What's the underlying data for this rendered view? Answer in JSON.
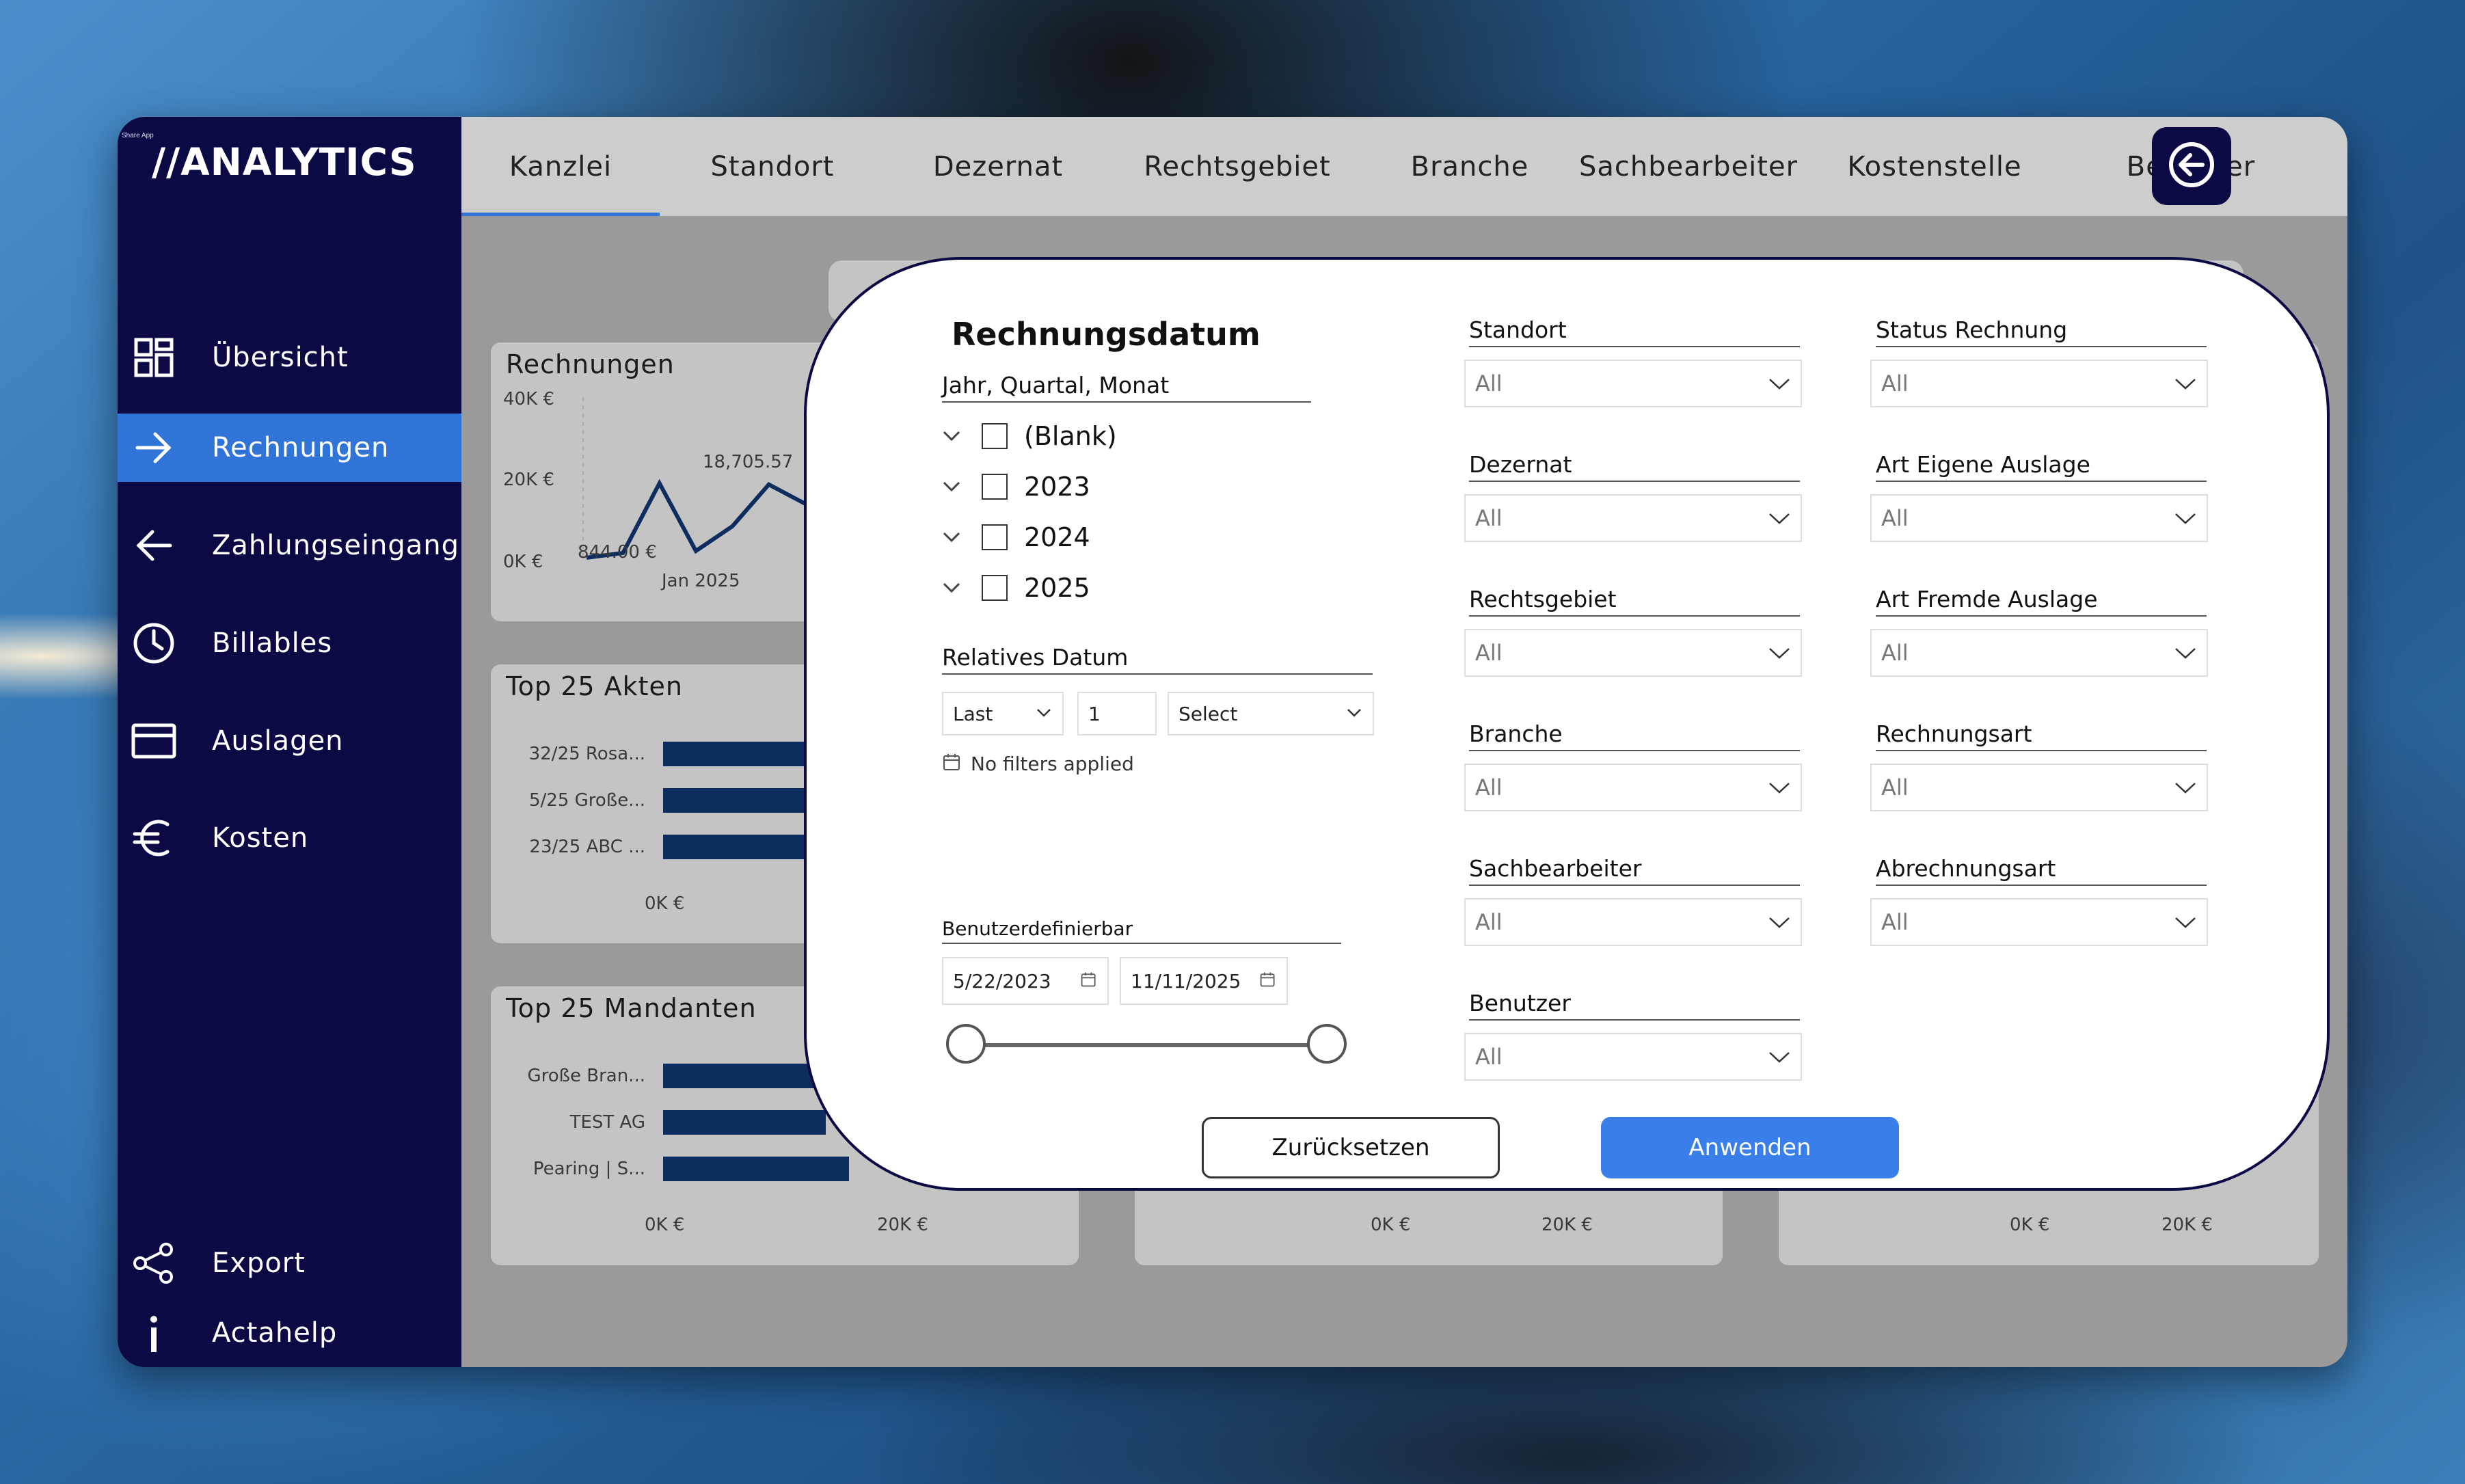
{
  "app": {
    "share_label": "Share App",
    "logo": "//ANALYTICS"
  },
  "sidebar": {
    "items": [
      {
        "label": "Übersicht",
        "icon": "dashboard-icon"
      },
      {
        "label": "Rechnungen",
        "icon": "arrow-right-icon",
        "active": true
      },
      {
        "label": "Zahlungseingang",
        "icon": "arrow-left-icon"
      },
      {
        "label": "Billables",
        "icon": "clock-icon"
      },
      {
        "label": "Auslagen",
        "icon": "card-icon"
      },
      {
        "label": "Kosten",
        "icon": "euro-icon"
      }
    ],
    "bottom": [
      {
        "label": "Export",
        "icon": "share-icon"
      },
      {
        "label": "Actahelp",
        "icon": "info-icon"
      }
    ]
  },
  "tabs": [
    "Kanzlei",
    "Standort",
    "Dezernat",
    "Rechtsgebiet",
    "Branche",
    "Sachbearbeiter",
    "Kostenstelle",
    "Benutzer"
  ],
  "active_tab": "Kanzlei",
  "cards": {
    "rechnungen": {
      "title": "Rechnungen",
      "y_ticks": [
        "40K €",
        "20K €",
        "0K €"
      ],
      "data_labels": [
        "18,705.57",
        "844.00 €"
      ],
      "x_label": "Jan 2025"
    },
    "top_akten": {
      "title": "Top 25 Akten",
      "rows": [
        "32/25 Rosa...",
        "5/25 Große...",
        "23/25 ABC ..."
      ],
      "x_ticks": [
        "0K €"
      ]
    },
    "top_mandanten": {
      "title": "Top 25 Mandanten",
      "rows": [
        "Große Bran...",
        "TEST AG",
        "Pearing | S..."
      ],
      "x_ticks": [
        "0K €",
        "20K €"
      ]
    },
    "mid_card": {
      "x_ticks": [
        "0K €",
        "20K €"
      ]
    },
    "right_card": {
      "x_ticks": [
        "0K €",
        "20K €"
      ]
    }
  },
  "chart_data": [
    {
      "type": "line",
      "title": "Rechnungen",
      "ylim": [
        0,
        40000
      ],
      "y_ticks": [
        "40K €",
        "20K €",
        "0K €"
      ],
      "x_label": "Jan 2025",
      "values": [
        844,
        2000,
        19000,
        2500,
        8500,
        18705.57,
        14000
      ],
      "annotations": [
        "18,705.57",
        "844.00 €"
      ]
    },
    {
      "type": "bar",
      "title": "Top 25 Akten",
      "categories": [
        "32/25 Rosa...",
        "5/25 Große...",
        "23/25 ABC ..."
      ]
    },
    {
      "type": "bar",
      "title": "Top 25 Mandanten",
      "categories": [
        "Große Bran...",
        "TEST AG",
        "Pearing | S..."
      ],
      "values": [
        17500,
        14000,
        16000
      ],
      "xlim": [
        0,
        20000
      ]
    }
  ],
  "modal": {
    "title": "Rechnungsdatum",
    "hierarchy_label": "Jahr, Quartal, Monat",
    "hierarchy_items": [
      "(Blank)",
      "2023",
      "2024",
      "2025"
    ],
    "relative_label": "Relatives Datum",
    "relative_period": "Last",
    "relative_count": "1",
    "relative_unit": "Select",
    "no_filters": "No filters applied",
    "custom_label": "Benutzerdefinierbar",
    "date_from": "5/22/2023",
    "date_to": "11/11/2025",
    "filters_left": [
      {
        "label": "Standort",
        "value": "All"
      },
      {
        "label": "Dezernat",
        "value": "All"
      },
      {
        "label": "Rechtsgebiet",
        "value": "All"
      },
      {
        "label": "Branche",
        "value": "All"
      },
      {
        "label": "Sachbearbeiter",
        "value": "All"
      },
      {
        "label": "Benutzer",
        "value": "All"
      }
    ],
    "filters_right": [
      {
        "label": "Status Rechnung",
        "value": "All"
      },
      {
        "label": "Art Eigene Auslage",
        "value": "All"
      },
      {
        "label": "Art Fremde Auslage",
        "value": "All"
      },
      {
        "label": "Rechnungsart",
        "value": "All"
      },
      {
        "label": "Abrechnungsart",
        "value": "All"
      }
    ],
    "reset_label": "Zurücksetzen",
    "apply_label": "Anwenden",
    "accent": "#3a7ee9"
  }
}
